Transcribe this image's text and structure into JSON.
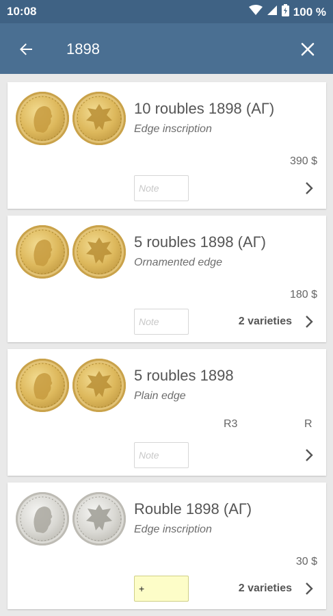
{
  "status_bar": {
    "time": "10:08",
    "battery_pct": "100 %"
  },
  "search": {
    "query": "1898",
    "back_icon": "arrow-back-icon",
    "clear_icon": "close-icon"
  },
  "colors": {
    "app_bar": "#4a6f92",
    "status_bar": "#3f6284",
    "gold": "#ddb85c",
    "silver": "#d9d8d3",
    "note_filled": "#fdfdc8"
  },
  "results": [
    {
      "title": "10 roubles 1898 (АГ)",
      "subtitle": "Edge inscription",
      "price": "390 $",
      "note_placeholder": "Note",
      "metal": "gold"
    },
    {
      "title": "5 roubles 1898 (АГ)",
      "subtitle": "Ornamented edge",
      "price": "180 $",
      "note_placeholder": "Note",
      "varieties": "2 varieties",
      "metal": "gold"
    },
    {
      "title": "5 roubles 1898",
      "subtitle": "Plain edge",
      "rarity_a": "R3",
      "rarity_b": "R",
      "note_placeholder": "Note",
      "metal": "gold"
    },
    {
      "title": "Rouble 1898 (АГ)",
      "subtitle": "Edge inscription",
      "price": "30 $",
      "note_value": "+",
      "varieties": "2 varieties",
      "metal": "silver"
    }
  ]
}
